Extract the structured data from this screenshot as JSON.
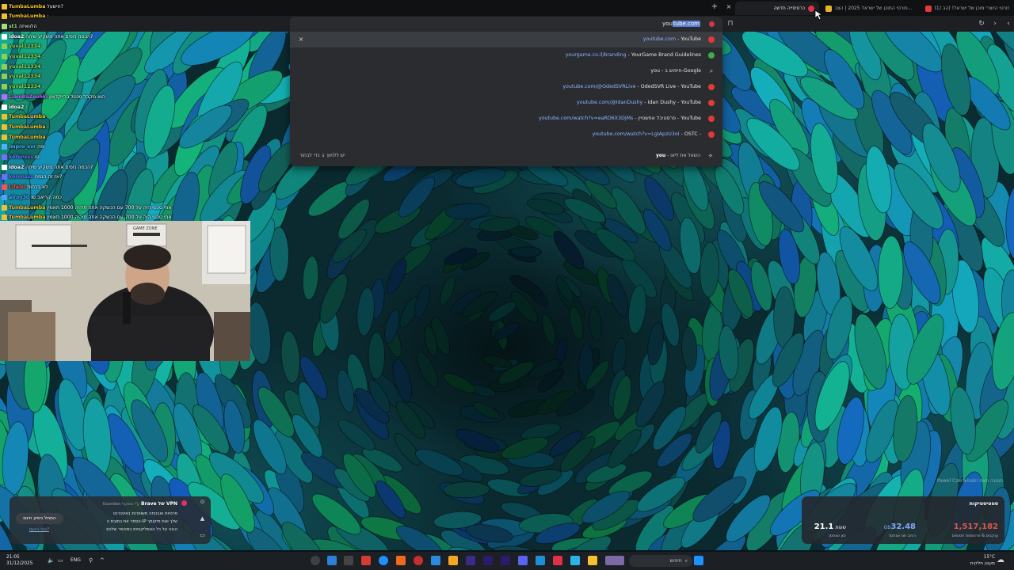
{
  "browser": {
    "tabs": [
      {
        "label": "(1) לייב פורטי היוצרי מוכן של ישראל! (הב...",
        "favicon_color": "#e23a3a"
      },
      {
        "label": "פורטי התוכן של ישראל 2025 | הצב...",
        "favicon_color": "#e6b628"
      },
      {
        "label": "כרטיסייה חדשה",
        "favicon_color": "#e0314b"
      }
    ],
    "new_tab_icon": "+",
    "close_icon": "×",
    "address_typed": "you",
    "address_autocomplete": "tube.com"
  },
  "omnibox": {
    "suggestions": [
      {
        "url": "youtube.com",
        "title": "YouTube",
        "icon": "youtube-icon",
        "icon_color": "#e23a3a"
      },
      {
        "url": "yourgame.co.il/branding",
        "title": "YourGame Brand Guidelines",
        "icon": "yourgame-icon",
        "icon_color": "#3fae4a"
      },
      {
        "url": "",
        "title": "you - חיפוש ב-Google",
        "icon": "search-icon",
        "icon_color": ""
      },
      {
        "url": "youtube.com/@OdedSVRLive",
        "title": "OdedSVR Live - YouTube",
        "icon": "youtube-icon",
        "icon_color": "#e23a3a"
      },
      {
        "url": "youtube.com/@IdanDushy",
        "title": "Idan Dushy - YouTube",
        "icon": "youtube-icon",
        "icon_color": "#e23a3a"
      },
      {
        "url": "youtube.com/watch?v=eaRD6X3DjMs",
        "title": "פרסטיבל אפשטיין - YouTube",
        "icon": "youtube-icon",
        "icon_color": "#e23a3a"
      },
      {
        "url": "youtube.com/watch?v=LgIApzU3oI",
        "title": "OSTC -",
        "icon": "ostc-icon",
        "icon_color": "#e23a3a"
      }
    ],
    "footer_left": "יש ללחוץ ↓ כדי לבחור",
    "footer_right_prefix": "you",
    "footer_right_text": " - השאל את ליאו"
  },
  "chat": [
    {
      "user": "TumbaLumba",
      "msg": "חישעל?",
      "color": "#f0c030"
    },
    {
      "user": "TumbaLumba",
      "msg": ":",
      "color": "#f0c030"
    },
    {
      "user": "st1",
      "msg": "הלוואיזה",
      "color": "#a0e080"
    },
    {
      "user": "idoa2",
      "msg": "הכמה נזפים אתה משקיע שיחה?",
      "color": "#ffffff"
    },
    {
      "user": "yuval12334",
      "msg": ":",
      "color": "#8fd14f"
    },
    {
      "user": "yuval12334",
      "msg": ":",
      "color": "#8fd14f"
    },
    {
      "user": "yuval12334",
      "msg": ":",
      "color": "#8fd14f"
    },
    {
      "user": "yuval12334",
      "msg": ":",
      "color": "#8fd14f"
    },
    {
      "user": "yuval12334",
      "msg": ":",
      "color": "#8fd14f"
    },
    {
      "user": "LiamBaZeohki",
      "msg": "הוא מקבל מנטל ברייקדאון",
      "color": "#b070ff"
    },
    {
      "user": "idoa2",
      "msg": ":",
      "color": "#ffffff"
    },
    {
      "user": "TumbaLumba",
      "msg": ":",
      "color": "#f0c030"
    },
    {
      "user": "TumbaLumba",
      "msg": ":",
      "color": "#f0c030"
    },
    {
      "user": "TumbaLumba",
      "msg": ":",
      "color": "#f0c030"
    },
    {
      "user": "impro_svr",
      "msg": "יפה",
      "color": "#50b0ff"
    },
    {
      "user": "korensss",
      "msg": "טו",
      "color": "#7070ff"
    },
    {
      "user": "idoa2",
      "msg": "הכמה נזפים אתה משקיע שיחה?",
      "color": "#ffffff"
    },
    {
      "user": "korensss",
      "msg": "אז זה הנמח?",
      "color": "#7070ff"
    },
    {
      "user": "Lifelxl",
      "msg": "לא ברחות",
      "color": "#ff5050"
    },
    {
      "user": "alroy30",
      "msg": "כמה קריאב שו",
      "color": "#50a0ff"
    },
    {
      "user": "TumbaLumba",
      "msg": "אחי טכטי היה על 700 עם הכשקה אתה תיהיה 1000 תאמין",
      "color": "#f0c030"
    },
    {
      "user": "TumbaLumba",
      "msg": "אחי טכטי היה על 700 עם הכשקה אתה תיהיה 1000 תאמין",
      "color": "#f0c030"
    }
  ],
  "webcam_sign": "GAME ZONE",
  "wallpaper_credit": "Pawel Czerwinski תמונה מאת",
  "vpn": {
    "title": "Brave של VPN",
    "subtitle": "Guardian ע\"י מופעל",
    "bullets": [
      "פרטיות ואבטחה משופרות באינטרנט",
      "הסתר את כתובת ה-IP שלך ואת מיקומך",
      "הגנה על כל האפליקציות במכשיר שלכם"
    ],
    "button": "התחל ניסיון חינם",
    "link": "כבר רכשת?"
  },
  "stats": {
    "title": "סטטיסטיקות",
    "items": [
      {
        "value": "1,517,182",
        "unit": "",
        "label": "עוקבים & פרסומות חסומים",
        "color": "#e0564a"
      },
      {
        "value": "32.48",
        "unit": "GB",
        "label": "רוחב פס שנחסך",
        "color": "#7fa8ff"
      },
      {
        "value": "21.1",
        "unit": "שעות",
        "label": "זמן שנחסך",
        "color": "#ffffff"
      }
    ]
  },
  "taskbar": {
    "time": "21:05",
    "date": "31/12/2025",
    "lang": "ENG",
    "search": "חיפוש",
    "weather_temp": "15°C",
    "weather_desc": "מעונן חלקית"
  }
}
